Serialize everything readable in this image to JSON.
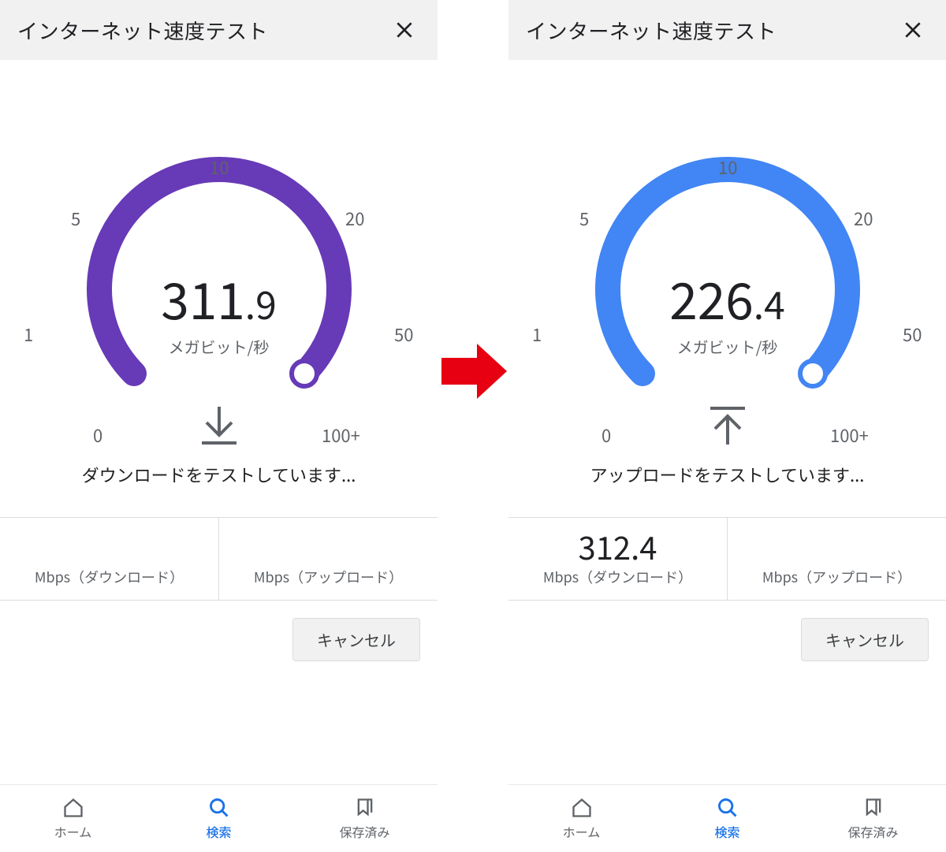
{
  "left": {
    "header": {
      "title": "インターネット速度テスト"
    },
    "gauge": {
      "color": "#673ab7",
      "ticks": {
        "zero": "0",
        "one": "1",
        "five": "5",
        "ten": "10",
        "twenty": "20",
        "fifty": "50",
        "hundred": "100+"
      },
      "value_int": "311",
      "value_dec": ".9",
      "unit": "メガビット/秒",
      "direction": "download",
      "status": "ダウンロードをテストしています..."
    },
    "results": {
      "download": {
        "value": "",
        "label": "Mbps（ダウンロード）"
      },
      "upload": {
        "value": "",
        "label": "Mbps（アップロード）"
      }
    },
    "cancel": "キャンセル",
    "nav": {
      "home": "ホーム",
      "search": "検索",
      "saved": "保存済み"
    }
  },
  "right": {
    "header": {
      "title": "インターネット速度テスト"
    },
    "gauge": {
      "color": "#4285f4",
      "ticks": {
        "zero": "0",
        "one": "1",
        "five": "5",
        "ten": "10",
        "twenty": "20",
        "fifty": "50",
        "hundred": "100+"
      },
      "value_int": "226",
      "value_dec": ".4",
      "unit": "メガビット/秒",
      "direction": "upload",
      "status": "アップロードをテストしています..."
    },
    "results": {
      "download": {
        "value": "312.4",
        "label": "Mbps（ダウンロード）"
      },
      "upload": {
        "value": "",
        "label": "Mbps（アップロード）"
      }
    },
    "cancel": "キャンセル",
    "nav": {
      "home": "ホーム",
      "search": "検索",
      "saved": "保存済み"
    }
  }
}
